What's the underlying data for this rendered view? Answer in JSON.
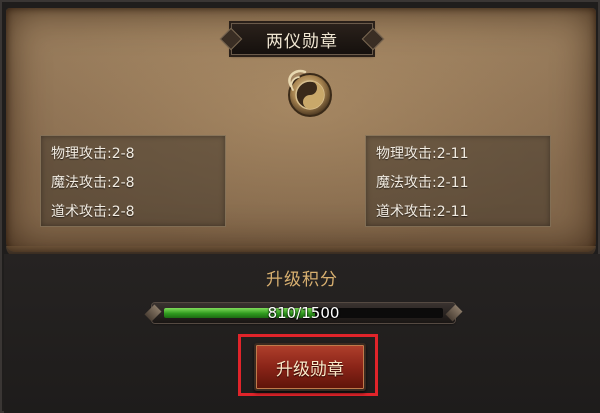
{
  "panel": {
    "title": "两仪勋章",
    "medal_icon": "taiji-medal-icon"
  },
  "stats_current": [
    {
      "label": "物理攻击:2-8"
    },
    {
      "label": "魔法攻击:2-8"
    },
    {
      "label": "道术攻击:2-8"
    }
  ],
  "stats_next": [
    {
      "label": "物理攻击:2-11"
    },
    {
      "label": "魔法攻击:2-11"
    },
    {
      "label": "道术攻击:2-11"
    }
  ],
  "upgrade": {
    "points_label": "升级积分",
    "progress_text": "810/1500",
    "progress_fraction": 0.54,
    "button_label": "升级勋章"
  },
  "colors": {
    "accent_gold": "#d8b070",
    "progress_green": "#2f9a1e",
    "highlight_red": "#e0242a",
    "button_red": "#8a2418"
  }
}
